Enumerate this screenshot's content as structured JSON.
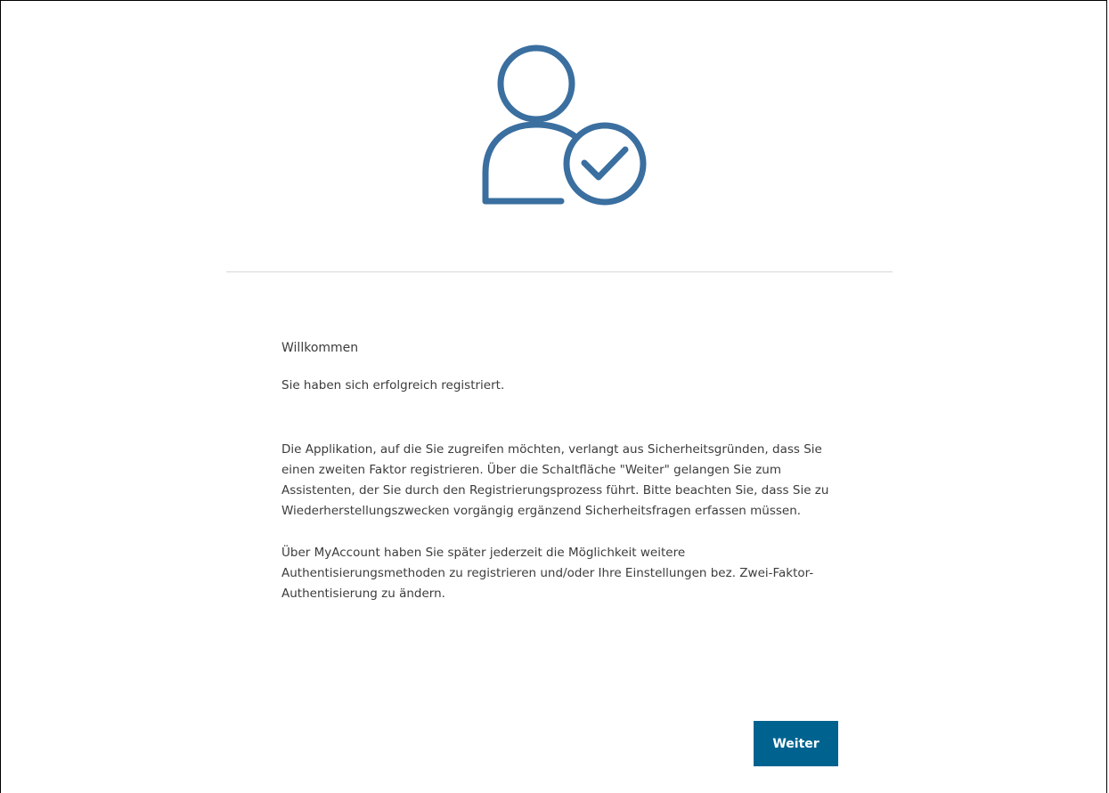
{
  "icons": {
    "hero": "user-check-icon",
    "color": "#3a6fa0"
  },
  "content": {
    "heading": "Willkommen",
    "success": "Sie haben sich erfolgreich registriert.",
    "paragraph_one": "Die Applikation, auf die Sie zugreifen möchten, verlangt aus Sicherheitsgründen, dass Sie einen zweiten Faktor registrieren. Über die Schaltfläche \"Weiter\" gelangen Sie zum Assistenten, der Sie durch den Registrierungsprozess führt. Bitte beachten Sie, dass Sie zu Wiederherstellungszwecken vorgängig ergänzend Sicherheitsfragen erfassen müssen.",
    "paragraph_two": "Über MyAccount haben Sie später jederzeit die Möglichkeit weitere Authentisierungsmethoden zu registrieren und/oder Ihre Einstellungen bez. Zwei-Faktor-Authentisierung zu ändern."
  },
  "actions": {
    "continue_label": "Weiter"
  },
  "colors": {
    "button_bg": "#00638f",
    "divider": "#d6d6d6"
  }
}
